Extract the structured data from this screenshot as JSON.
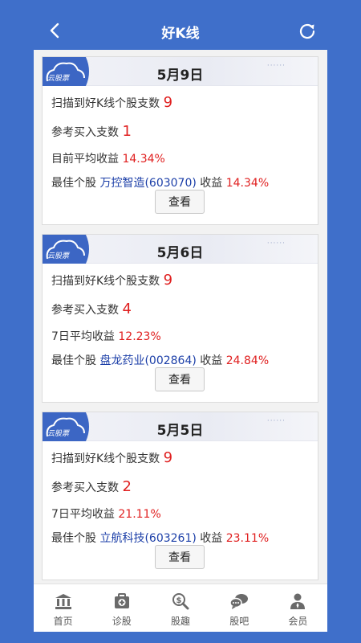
{
  "header": {
    "title": "好K线",
    "back_icon": "chevron-left-icon",
    "refresh_icon": "refresh-icon"
  },
  "colors": {
    "background": "#3f6fca",
    "highlight_red": "#e02020",
    "stock_blue": "#1c3fa8"
  },
  "cards": [
    {
      "logo_text": "云股票",
      "date": "5月9日",
      "scan_label": "扫描到好K线个股支数",
      "scan_count": "9",
      "buy_label": "参考买入支数",
      "buy_count": "1",
      "avg_label": "目前平均收益",
      "avg_value": "14.34%",
      "best_label": "最佳个股",
      "best_stock": "万控智造(603070)",
      "best_return_label": "收益",
      "best_return": "14.34%",
      "button_label": "查看"
    },
    {
      "logo_text": "云股票",
      "date": "5月6日",
      "scan_label": "扫描到好K线个股支数",
      "scan_count": "9",
      "buy_label": "参考买入支数",
      "buy_count": "4",
      "avg_label": "7日平均收益",
      "avg_value": "12.23%",
      "best_label": "最佳个股",
      "best_stock": "盘龙药业(002864)",
      "best_return_label": "收益",
      "best_return": "24.84%",
      "button_label": "查看"
    },
    {
      "logo_text": "云股票",
      "date": "5月5日",
      "scan_label": "扫描到好K线个股支数",
      "scan_count": "9",
      "buy_label": "参考买入支数",
      "buy_count": "2",
      "avg_label": "7日平均收益",
      "avg_value": "21.11%",
      "best_label": "最佳个股",
      "best_stock": "立航科技(603261)",
      "best_return_label": "收益",
      "best_return": "23.11%",
      "button_label": "查看"
    }
  ],
  "tabs": [
    {
      "label": "首页",
      "icon": "bank-icon"
    },
    {
      "label": "诊股",
      "icon": "medical-kit-icon"
    },
    {
      "label": "股趣",
      "icon": "magnifier-dollar-icon"
    },
    {
      "label": "股吧",
      "icon": "chat-bubbles-icon"
    },
    {
      "label": "会员",
      "icon": "user-icon"
    }
  ]
}
